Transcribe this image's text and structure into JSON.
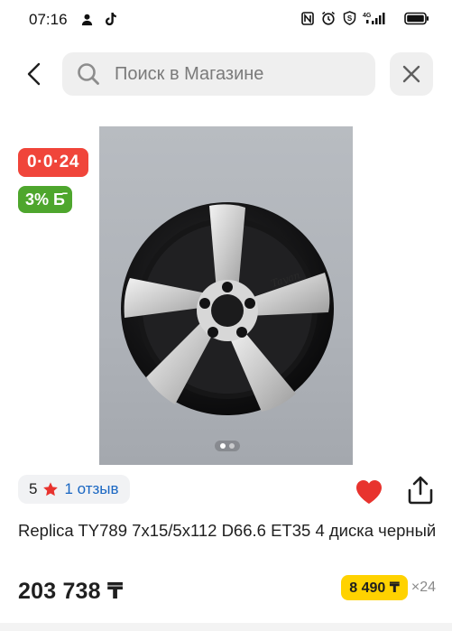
{
  "status_bar": {
    "time": "07:16",
    "left_icons": [
      "person-icon",
      "tiktok-icon"
    ],
    "right_icons": [
      "nfc-icon",
      "alarm-icon",
      "vpn-icon",
      "signal-4g-icon",
      "battery-icon"
    ],
    "network_label": "4G"
  },
  "search": {
    "placeholder": "Поиск в Магазине",
    "value": ""
  },
  "badges": {
    "installment": "0·0·24",
    "bonus": "3% Б̄",
    "installment_color": "#f0453a",
    "bonus_color": "#4ea62d"
  },
  "gallery": {
    "total_images": 2,
    "active_index": 0
  },
  "rating": {
    "value": "5",
    "reviews_text": "1 отзыв",
    "star_color": "#e8332e"
  },
  "product": {
    "title": "Replica TY789 7x15/5x112 D66.6 ET35 4 диска черный",
    "price": "203 738 ₸",
    "monthly_payment": "8 490 ₸",
    "monthly_term": "×24"
  },
  "colors": {
    "favorite": "#e8332e",
    "link": "#1966c2",
    "installment_highlight": "#ffd200"
  }
}
